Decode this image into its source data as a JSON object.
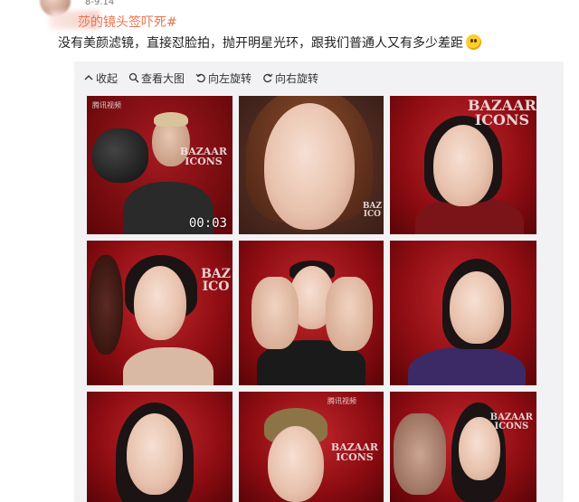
{
  "post": {
    "meta": "8-9.14",
    "hashtag": "莎的镜头签吓死#",
    "caption": "没有美颜滤镜，直接怼脸拍，抛开明星光环，跟我们普通人又有多少差距",
    "emoji_icon": "flushed-emoji"
  },
  "toolbar": {
    "items": [
      {
        "label": "收起",
        "icon": "collapse-icon"
      },
      {
        "label": "查看大图",
        "icon": "zoom-in-icon"
      },
      {
        "label": "向左旋转",
        "icon": "rotate-left-icon"
      },
      {
        "label": "向右旋转",
        "icon": "rotate-right-icon"
      }
    ]
  },
  "photos": [
    {
      "duration": "00:03",
      "watermark": "腾讯视频",
      "brand": "BAZAAR\nICONS"
    },
    {
      "brand": "BAZ\nICO"
    },
    {
      "brand": "BAZAAR\nICONS"
    },
    {
      "brand": "BAZ\nICO"
    },
    {
      "brand": ""
    },
    {
      "brand": ""
    },
    {
      "brand": ""
    },
    {
      "watermark": "腾讯视频",
      "brand": "BAZAAR\nICONS"
    },
    {
      "brand": "BAZAAR\nICONS"
    }
  ],
  "colors": {
    "accent": "#eb7350",
    "card": "#f2f2f5",
    "backdrop": "#9b1016"
  }
}
